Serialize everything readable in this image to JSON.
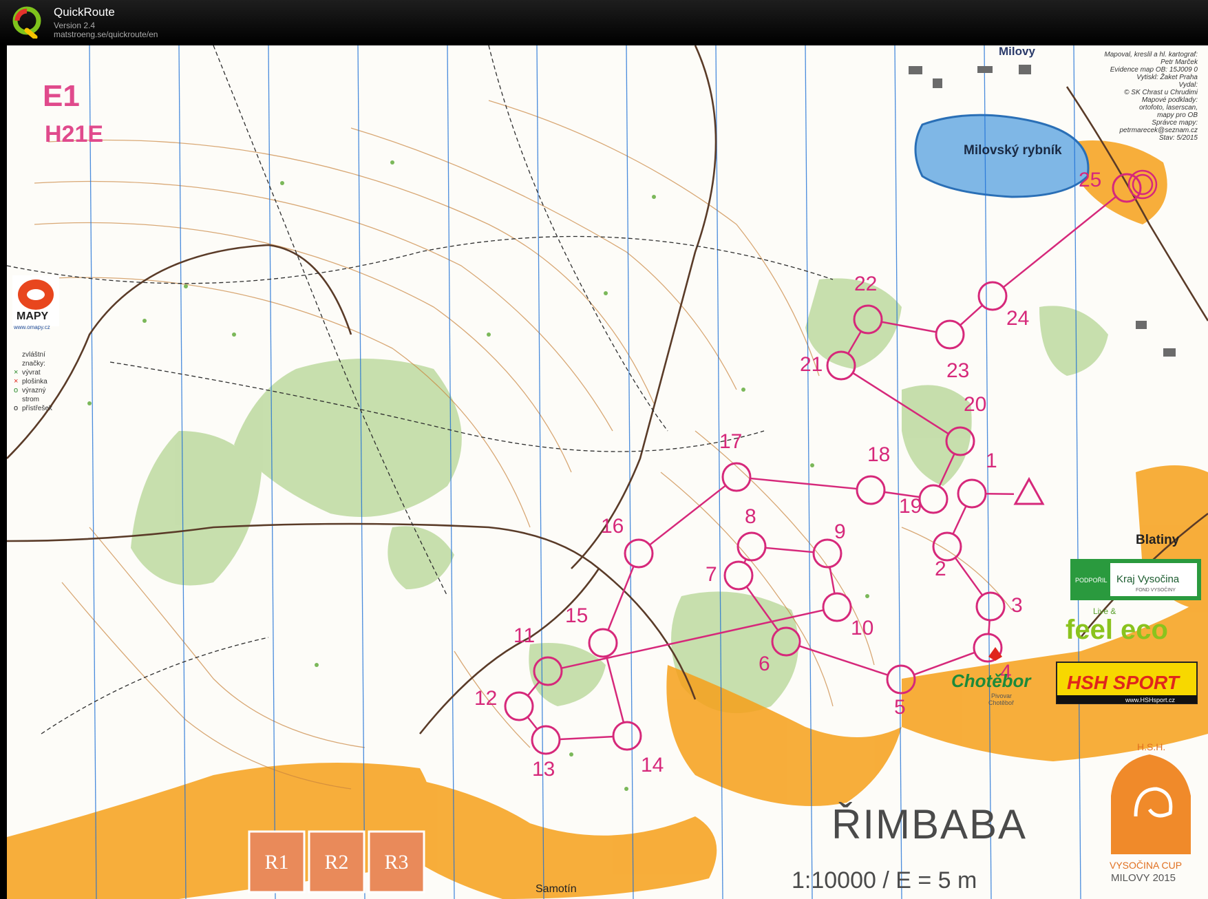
{
  "app": {
    "name": "QuickRoute",
    "version": "Version 2.4",
    "url": "matstroeng.se/quickroute/en",
    "logo_letter": "Q"
  },
  "map": {
    "event_code": "E1",
    "category": "H21E",
    "name": "ŘIMBABA",
    "scale_text": "1:10000 / E = 5 m",
    "lake_name": "Milovský rybník",
    "place_milovy": "Milovy",
    "place_blatiny": "Blatiny",
    "place_samotin": "Samotín",
    "credits": [
      "Mapoval, kreslil a hl. kartograf:",
      "Petr Marček",
      "Evidence map OB: 15J009 0",
      "Vytiskl: Žaket Praha",
      "Vydal:",
      "© SK Chrast u Chrudimi",
      "Mapové podklady:",
      "ortofoto, laserscan,",
      "mapy pro OB",
      "Správce mapy:",
      "petrmarecek@seznam.cz",
      "Stav: 5/2015"
    ],
    "legend": [
      "zvláštní",
      "značky:",
      "vývrat",
      "plošinka",
      "výrazný",
      "strom",
      "přístřešek"
    ],
    "mapy_logo": "MAPY",
    "mapy_url": "www.omapy.cz",
    "sponsors": {
      "kraj_prefix": "PODPOŘIL",
      "kraj_name": "Kraj Vysočina",
      "kraj_sub": "FOND VYSOČINY",
      "feel_eco_small": "Live &",
      "feel_eco": "feel eco",
      "hsh": "HSH SPORT",
      "hsh_url": "www.HSHsport.cz",
      "chotebor": "Chotěbor",
      "chotebor_sub1": "Pivovar",
      "chotebor_sub2": "Chotěboř"
    },
    "cup_badge_top": "H.S.H.",
    "cup_badge_bottom": "VYSOČINA CUP",
    "cup_badge_bottom2": "MILOVY 2015",
    "relay_boxes": [
      "R1",
      "R2",
      "R3"
    ],
    "course_color": "#d6287a",
    "controls": [
      {
        "number": "1"
      },
      {
        "number": "2"
      },
      {
        "number": "3"
      },
      {
        "number": "4"
      },
      {
        "number": "5"
      },
      {
        "number": "6"
      },
      {
        "number": "7"
      },
      {
        "number": "8"
      },
      {
        "number": "9"
      },
      {
        "number": "10"
      },
      {
        "number": "11"
      },
      {
        "number": "12"
      },
      {
        "number": "13"
      },
      {
        "number": "14"
      },
      {
        "number": "15"
      },
      {
        "number": "16"
      },
      {
        "number": "17"
      },
      {
        "number": "18"
      },
      {
        "number": "19"
      },
      {
        "number": "20"
      },
      {
        "number": "21"
      },
      {
        "number": "22"
      },
      {
        "number": "23"
      },
      {
        "number": "24"
      },
      {
        "number": "25"
      }
    ]
  }
}
